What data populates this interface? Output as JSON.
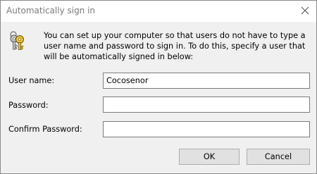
{
  "window": {
    "title": "Automatically sign in"
  },
  "message": "You can set up your computer so that users do not have to type a user name and password to sign in. To do this, specify a user that will be automatically signed in below:",
  "fields": [
    {
      "label": "User name:",
      "value": "Cocosenor"
    },
    {
      "label": "Password:",
      "value": ""
    },
    {
      "label": "Confirm Password:",
      "value": ""
    }
  ],
  "buttons": {
    "ok": "OK",
    "cancel": "Cancel"
  },
  "icons": {
    "close": "close-icon",
    "keys": "keys-icon"
  }
}
